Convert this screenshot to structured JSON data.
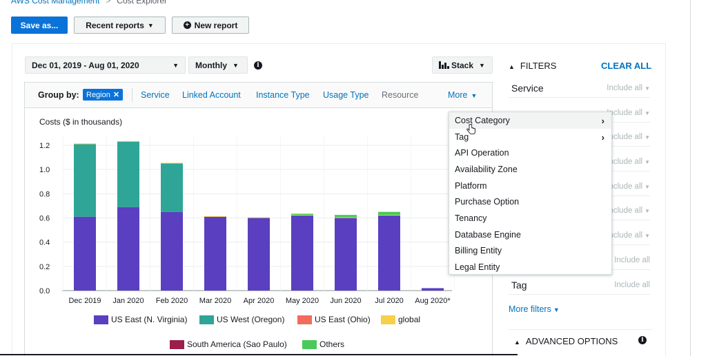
{
  "breadcrumb": {
    "parent": "AWS Cost Management",
    "separator": ">",
    "current": "Cost Explorer"
  },
  "toolbar": {
    "save_label": "Save as...",
    "recent_label": "Recent reports",
    "new_label": "New report"
  },
  "controls": {
    "date_range": "Dec 01, 2019 - Aug 01, 2020",
    "granularity": "Monthly",
    "chart_style": "Stack"
  },
  "group_by": {
    "label": "Group by:",
    "selected": "Region",
    "options": [
      "Service",
      "Linked Account",
      "Instance Type",
      "Usage Type",
      "Resource"
    ],
    "more_label": "More"
  },
  "more_menu": {
    "items": [
      "Cost Category",
      "Tag",
      "API Operation",
      "Availability Zone",
      "Platform",
      "Purchase Option",
      "Tenancy",
      "Database Engine",
      "Billing Entity",
      "Legal Entity"
    ]
  },
  "filters": {
    "heading": "FILTERS",
    "clear_label": "CLEAR ALL",
    "rows": [
      {
        "name": "Service",
        "value": "Include all"
      },
      {
        "name": "",
        "value": "Include all"
      },
      {
        "name": "",
        "value": "Include all"
      },
      {
        "name": "",
        "value": "Include all"
      },
      {
        "name": "",
        "value": "Include all"
      },
      {
        "name": "",
        "value": "Include all"
      },
      {
        "name": "",
        "value": "Include all"
      },
      {
        "name": "",
        "value": "Include all"
      },
      {
        "name": "Tag",
        "value": "Include all"
      }
    ],
    "more_label": "More filters",
    "advanced_label": "ADVANCED OPTIONS"
  },
  "chart_data": {
    "type": "bar",
    "stacked": true,
    "ylabel": "Costs ($ in thousands)",
    "ylim": [
      0,
      1.2
    ],
    "yticks": [
      "0.0",
      "0.2",
      "0.4",
      "0.6",
      "0.8",
      "1.0",
      "1.2"
    ],
    "categories": [
      "Dec 2019",
      "Jan 2020",
      "Feb 2020",
      "Mar 2020",
      "Apr 2020",
      "May 2020",
      "Jun 2020",
      "Jul 2020",
      "Aug 2020*"
    ],
    "series": [
      {
        "name": "US East (N. Virginia)",
        "color": "#5a3fc0",
        "values": [
          0.61,
          0.69,
          0.65,
          0.61,
          0.6,
          0.62,
          0.6,
          0.62,
          0.02
        ]
      },
      {
        "name": "US West (Oregon)",
        "color": "#2ea597",
        "values": [
          0.6,
          0.54,
          0.4,
          0.0,
          0.0,
          0.0,
          0.0,
          0.0,
          0.0
        ]
      },
      {
        "name": "US East (Ohio)",
        "color": "#f26b5b",
        "values": [
          0,
          0,
          0,
          0,
          0,
          0,
          0,
          0,
          0
        ]
      },
      {
        "name": "global",
        "color": "#f7cf48",
        "values": [
          0.005,
          0.005,
          0.005,
          0.005,
          0.005,
          0.005,
          0.005,
          0.005,
          0
        ]
      },
      {
        "name": "South America (Sao Paulo)",
        "color": "#9c1e4a",
        "values": [
          0,
          0,
          0,
          0,
          0,
          0,
          0,
          0,
          0
        ]
      },
      {
        "name": "Others",
        "color": "#4ac95b",
        "values": [
          0.0,
          0.0,
          0.0,
          0.0,
          0.0,
          0.01,
          0.02,
          0.025,
          0.0
        ]
      }
    ],
    "legend_position": "bottom",
    "grid": true
  }
}
